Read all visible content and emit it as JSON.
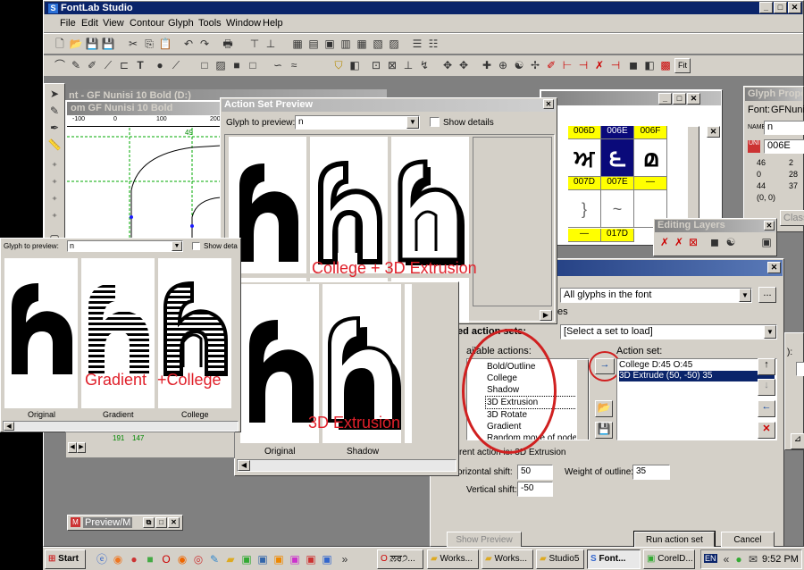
{
  "app": {
    "title": "FontLab Studio"
  },
  "menu": [
    "File",
    "Edit",
    "View",
    "Contour",
    "Glyph",
    "Tools",
    "Window",
    "Help"
  ],
  "toolbar2": {
    "fit_label": "Fit"
  },
  "glyph_window": {
    "title": "om GF Nunisi 10 Bold",
    "ruler": [
      "-100",
      "0",
      "100",
      "200"
    ],
    "ruler_value": "49",
    "coords": [
      "191",
      "147"
    ]
  },
  "back_title": "nt - GF Nunisi 10 Bold (D:)",
  "font_window": {
    "codes_row1": [
      "006D",
      "006E",
      "006F"
    ],
    "glyphs_row1": [
      "ਅ",
      "౬",
      "മ"
    ],
    "codes_row2": [
      "007D",
      "007E",
      "—"
    ],
    "glyphs_row2": [
      "}",
      "~",
      ""
    ],
    "codes_row3": [
      "—",
      "017D"
    ]
  },
  "glyph_props": {
    "title": "Glyph Properti",
    "font_label": "Font:",
    "font_value": "GFNunisi",
    "name_value": "n",
    "unicode_value": "006E",
    "metrics": [
      [
        "46",
        "2"
      ],
      [
        "0",
        "28"
      ],
      [
        "44",
        "37"
      ]
    ],
    "origin": "(0, 0)",
    "class_btn": "Class"
  },
  "editing_layers": {
    "title": "Editing Layers"
  },
  "action_preview": {
    "title": "Action Set Preview",
    "glyph_to_preview_label": "Glyph to preview:",
    "glyph_value": "n",
    "show_details": "Show details",
    "annot_college": "College + 3D Extrusion",
    "annot_3d": "3D Extrusion",
    "captions": [
      "Original",
      "Shadow"
    ]
  },
  "small_preview": {
    "glyph_to_preview_label": "Glyph to preview:",
    "glyph_value": "n",
    "show_details": "Show deta",
    "annot_gradient": "Gradient",
    "annot_college": "+College",
    "captions": [
      "Original",
      "Gradient",
      "College"
    ]
  },
  "actions_dialog": {
    "apply_to": "All glyphs in the font",
    "es_label": "es",
    "saved_sets_label": "ed action sets:",
    "set_placeholder": "[Select a set to load]",
    "available_label": "ailable actions:",
    "action_set_label": "Action set:",
    "available": [
      "Bold/Outline",
      "College",
      "Shadow",
      "3D Extrusion",
      "3D Rotate",
      "Gradient",
      "Random move of nodes"
    ],
    "selected_available": "3D Extrusion",
    "action_set": [
      "College D:45 O:45",
      "3D Extrude (50, -50) 35"
    ],
    "selected_set": "3D Extrude (50, -50) 35",
    "current_action": "rent action is: 3D Extrusion",
    "hshift_label": "orizontal shift:",
    "hshift_value": "50",
    "vshift_label": "Vertical shift:",
    "vshift_value": "-50",
    "weight_label": "Weight of outline:",
    "weight_value": "35",
    "show_preview": "Show Preview",
    "run": "Run action set",
    "cancel": "Cancel",
    "edge_label": "):"
  },
  "preview_mini": {
    "title": "Preview/M"
  },
  "taskbar": {
    "start": "Start",
    "tasks": [
      "ਲ਼ਰ੭...",
      "Works...",
      "Works...",
      "Studio5",
      "Font...",
      "CorelD..."
    ],
    "lang": "EN",
    "time": "9:52 PM"
  }
}
